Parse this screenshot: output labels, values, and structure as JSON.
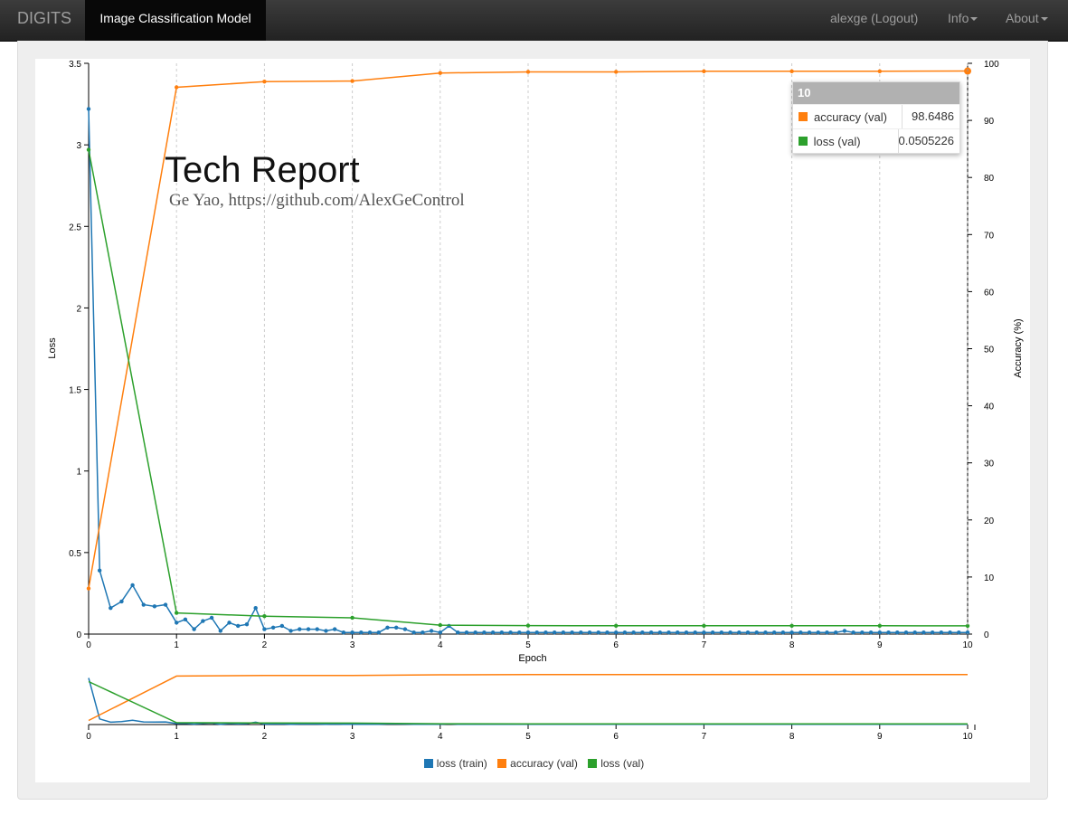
{
  "navbar": {
    "brand": "DIGITS",
    "active_title": "Image Classification Model",
    "user": "alexge (Logout)",
    "info": "Info",
    "about": "About"
  },
  "overlay": {
    "title": "Tech Report",
    "subtitle": "Ge Yao, https://github.com/AlexGeControl"
  },
  "tooltip": {
    "header": "10",
    "rows": [
      {
        "name": "accuracy (val)",
        "value": "98.6486",
        "color": "#ff7f0e"
      },
      {
        "name": "loss (val)",
        "value": "0.0505226",
        "color": "#2ca02c"
      }
    ]
  },
  "chart_data": {
    "type": "line",
    "xlabel": "Epoch",
    "ylabel": "Loss",
    "y2label": "Accuracy (%)",
    "xlim": [
      0,
      10
    ],
    "ylim": [
      0,
      3.5
    ],
    "y2lim": [
      0,
      100
    ],
    "x_ticks": [
      "0",
      "1",
      "2",
      "3",
      "4",
      "5",
      "6",
      "7",
      "8",
      "9",
      "10"
    ],
    "y_ticks": [
      "0",
      "0.5",
      "1",
      "1.5",
      "2",
      "2.5",
      "3",
      "3.5"
    ],
    "y2_ticks": [
      "0",
      "10",
      "20",
      "30",
      "40",
      "50",
      "60",
      "70",
      "80",
      "90",
      "100"
    ],
    "grid": "vertical dashed",
    "legend_position": "bottom-center",
    "series": [
      {
        "name": "loss (train)",
        "axis": "left",
        "color": "#1f77b4",
        "x": [
          0,
          0.125,
          0.25,
          0.375,
          0.5,
          0.625,
          0.75,
          0.875,
          1,
          1.1,
          1.2,
          1.3,
          1.4,
          1.5,
          1.6,
          1.7,
          1.8,
          1.9,
          2,
          2.1,
          2.2,
          2.3,
          2.4,
          2.5,
          2.6,
          2.7,
          2.8,
          2.9,
          3,
          3.1,
          3.2,
          3.3,
          3.4,
          3.5,
          3.6,
          3.7,
          3.8,
          3.9,
          4,
          4.1,
          4.2,
          4.3,
          4.4,
          4.5,
          4.6,
          4.7,
          4.8,
          4.9,
          5,
          5.1,
          5.2,
          5.3,
          5.4,
          5.5,
          5.6,
          5.7,
          5.8,
          5.9,
          6,
          6.1,
          6.2,
          6.3,
          6.4,
          6.5,
          6.6,
          6.7,
          6.8,
          6.9,
          7,
          7.1,
          7.2,
          7.3,
          7.4,
          7.5,
          7.6,
          7.7,
          7.8,
          7.9,
          8,
          8.1,
          8.2,
          8.3,
          8.4,
          8.5,
          8.6,
          8.7,
          8.8,
          8.9,
          9,
          9.1,
          9.2,
          9.3,
          9.4,
          9.5,
          9.6,
          9.7,
          9.8,
          9.9,
          10
        ],
        "values": [
          3.22,
          0.39,
          0.16,
          0.2,
          0.3,
          0.18,
          0.17,
          0.18,
          0.07,
          0.09,
          0.03,
          0.08,
          0.1,
          0.02,
          0.07,
          0.05,
          0.06,
          0.16,
          0.03,
          0.04,
          0.05,
          0.02,
          0.03,
          0.03,
          0.03,
          0.02,
          0.03,
          0.01,
          0.01,
          0.01,
          0.01,
          0.01,
          0.04,
          0.04,
          0.03,
          0.01,
          0.01,
          0.02,
          0.01,
          0.05,
          0.01,
          0.01,
          0.01,
          0.01,
          0.01,
          0.01,
          0.01,
          0.01,
          0.01,
          0.01,
          0.01,
          0.01,
          0.01,
          0.01,
          0.01,
          0.01,
          0.01,
          0.01,
          0.01,
          0.01,
          0.01,
          0.01,
          0.01,
          0.01,
          0.01,
          0.01,
          0.01,
          0.01,
          0.01,
          0.01,
          0.01,
          0.01,
          0.01,
          0.01,
          0.01,
          0.01,
          0.01,
          0.01,
          0.01,
          0.01,
          0.01,
          0.01,
          0.01,
          0.01,
          0.02,
          0.01,
          0.01,
          0.01,
          0.01,
          0.01,
          0.01,
          0.01,
          0.01,
          0.01,
          0.01,
          0.01,
          0.01,
          0.01,
          0.01
        ]
      },
      {
        "name": "accuracy (val)",
        "axis": "right",
        "color": "#ff7f0e",
        "x": [
          0,
          1,
          2,
          3,
          4,
          5,
          6,
          7,
          8,
          9,
          10
        ],
        "values": [
          8.0,
          95.8,
          96.8,
          96.9,
          98.3,
          98.5,
          98.5,
          98.6,
          98.6,
          98.6,
          98.6486
        ]
      },
      {
        "name": "loss (val)",
        "axis": "left",
        "color": "#2ca02c",
        "x": [
          0,
          1,
          2,
          3,
          4,
          5,
          6,
          7,
          8,
          9,
          10
        ],
        "values": [
          2.97,
          0.13,
          0.11,
          0.1,
          0.055,
          0.052,
          0.051,
          0.051,
          0.051,
          0.051,
          0.0505226
        ]
      }
    ]
  }
}
